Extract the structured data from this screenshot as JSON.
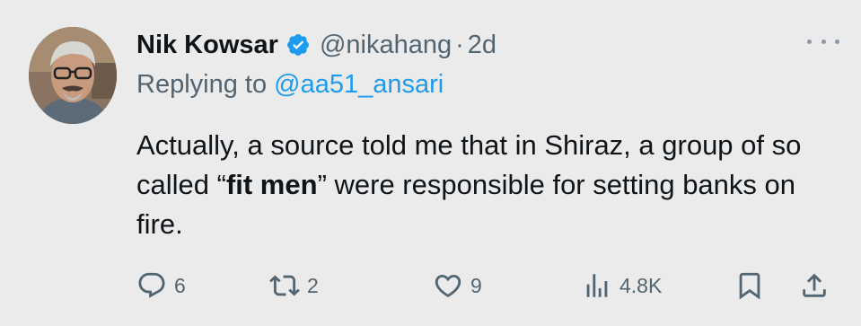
{
  "tweet": {
    "display_name": "Nik Kowsar",
    "handle": "@nikahang",
    "separator": "·",
    "time": "2d",
    "replying_prefix": "Replying to",
    "replying_handle": "@aa51_ansari",
    "text_part1": "Actually, a source told me that in Shiraz, a group of so called “",
    "text_bold": "fit men",
    "text_part2": "” were responsible for setting banks on fire."
  },
  "actions": {
    "replies": "6",
    "retweets": "2",
    "likes": "9",
    "views": "4.8K"
  },
  "colors": {
    "background": "#ebebeb",
    "primary_text": "#0f1419",
    "secondary_text": "#536471",
    "link": "#1d9bf0",
    "verified": "#1d9bf0"
  },
  "icons": {
    "more": "more-dots-icon",
    "verified": "verified-badge-icon",
    "reply": "reply-bubble-icon",
    "retweet": "retweet-icon",
    "like": "heart-icon",
    "views": "views-chart-icon",
    "bookmark": "bookmark-icon",
    "share": "share-upload-icon"
  }
}
